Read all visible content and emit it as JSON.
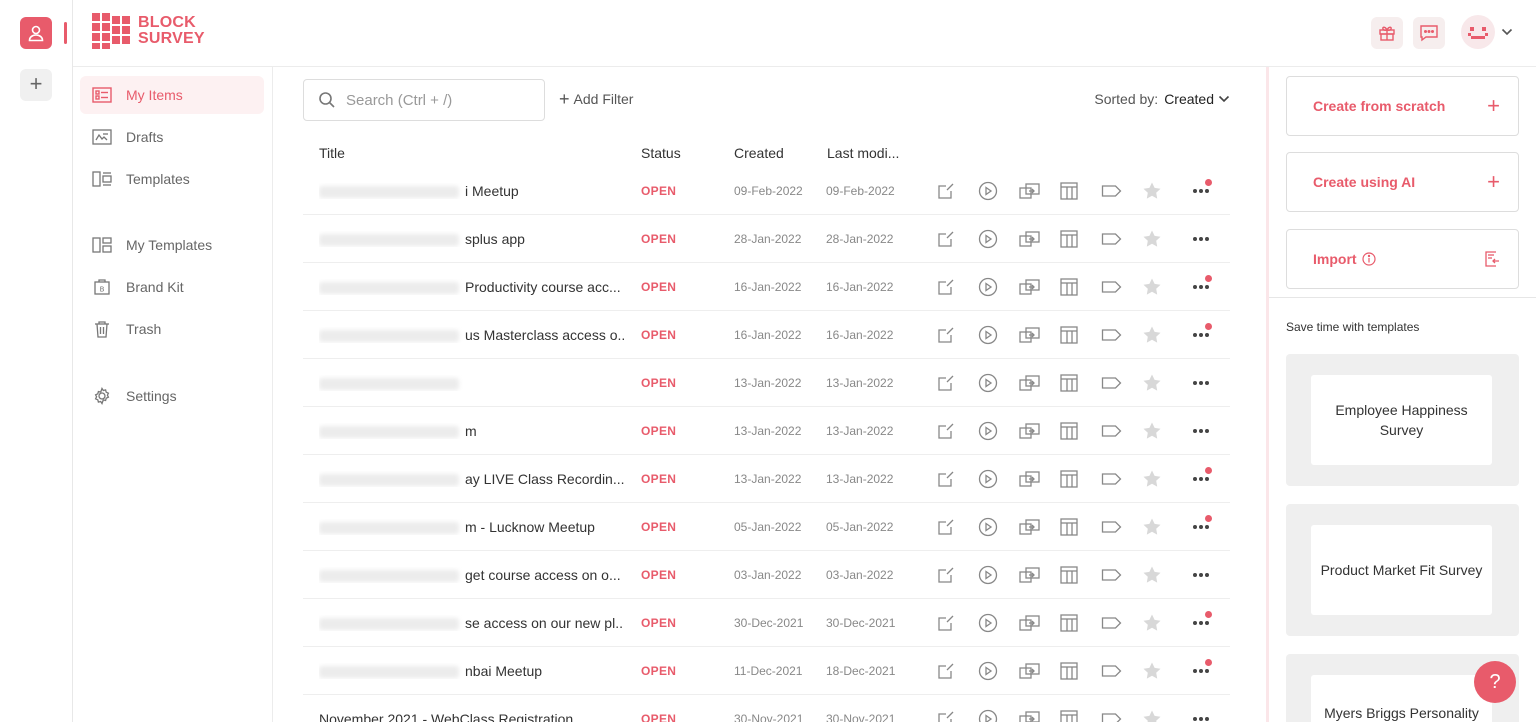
{
  "brand": {
    "line1": "BLOCK",
    "line2": "SURVEY",
    "color": "#e85b6b"
  },
  "nav": {
    "items": [
      {
        "label": "My Items",
        "icon": "list-icon",
        "active": true
      },
      {
        "label": "Drafts",
        "icon": "draft-icon"
      },
      {
        "label": "Templates",
        "icon": "templates-icon"
      },
      {
        "label": "My Templates",
        "icon": "my-templates-icon"
      },
      {
        "label": "Brand Kit",
        "icon": "brand-kit-icon"
      },
      {
        "label": "Trash",
        "icon": "trash-icon"
      },
      {
        "label": "Settings",
        "icon": "gear-icon"
      }
    ]
  },
  "toolbar": {
    "search_placeholder": "Search (Ctrl + /)",
    "add_filter": "Add Filter",
    "sorted_label": "Sorted by:",
    "sorted_value": "Created"
  },
  "table": {
    "headers": {
      "title": "Title",
      "status": "Status",
      "created": "Created",
      "modified": "Last modi..."
    },
    "rows": [
      {
        "title": "i Meetup",
        "status": "OPEN",
        "created": "09-Feb-2022",
        "modified": "09-Feb-2022",
        "badge": true
      },
      {
        "title": "splus app",
        "status": "OPEN",
        "created": "28-Jan-2022",
        "modified": "28-Jan-2022",
        "badge": false
      },
      {
        "title": "Productivity course acc...",
        "status": "OPEN",
        "created": "16-Jan-2022",
        "modified": "16-Jan-2022",
        "badge": true
      },
      {
        "title": "us Masterclass access o...",
        "status": "OPEN",
        "created": "16-Jan-2022",
        "modified": "16-Jan-2022",
        "badge": true
      },
      {
        "title": "",
        "status": "OPEN",
        "created": "13-Jan-2022",
        "modified": "13-Jan-2022",
        "badge": false
      },
      {
        "title": "m",
        "status": "OPEN",
        "created": "13-Jan-2022",
        "modified": "13-Jan-2022",
        "badge": false
      },
      {
        "title": "ay LIVE Class Recordin...",
        "status": "OPEN",
        "created": "13-Jan-2022",
        "modified": "13-Jan-2022",
        "badge": true
      },
      {
        "title": "m - Lucknow Meetup",
        "status": "OPEN",
        "created": "05-Jan-2022",
        "modified": "05-Jan-2022",
        "badge": true
      },
      {
        "title": "get course access on o...",
        "status": "OPEN",
        "created": "03-Jan-2022",
        "modified": "03-Jan-2022",
        "badge": false
      },
      {
        "title": "se access on our new pl...",
        "status": "OPEN",
        "created": "30-Dec-2021",
        "modified": "30-Dec-2021",
        "badge": true
      },
      {
        "title": "nbai Meetup",
        "status": "OPEN",
        "created": "11-Dec-2021",
        "modified": "18-Dec-2021",
        "badge": true
      },
      {
        "title": "November 2021 - WebClass Registration",
        "status": "OPEN",
        "created": "30-Nov-2021",
        "modified": "30-Nov-2021",
        "badge": false,
        "unblurred": true
      }
    ]
  },
  "right_panel": {
    "create_scratch": "Create from scratch",
    "create_ai": "Create using AI",
    "import": "Import",
    "subtitle": "Save time with templates",
    "templates": [
      "Employee Happiness Survey",
      "Product Market Fit Survey",
      "Myers Briggs Personality"
    ]
  },
  "help_label": "?"
}
